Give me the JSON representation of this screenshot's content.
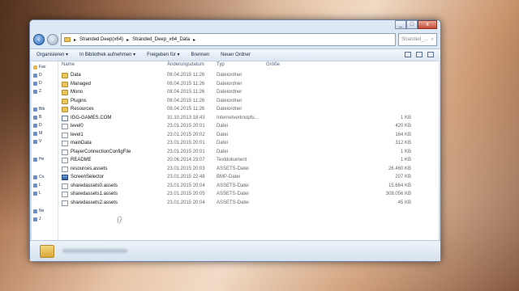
{
  "window": {
    "caption_buttons": [
      "minimize",
      "maximize",
      "close"
    ],
    "address": {
      "segments": [
        "Stranded Deep(x64)",
        "Stranded_Deep_x64_Data"
      ],
      "separator": "▸"
    },
    "search_placeholder": "Stranded_...",
    "toolbar": {
      "organize": "Organisieren ▾",
      "include_library": "In Bibliothek aufnehmen ▾",
      "share": "Freigeben für ▾",
      "burn": "Brennen",
      "new_folder": "Neuer Ordner"
    },
    "navpane": [
      {
        "label": "Fav",
        "icon": "star-icon"
      },
      {
        "label": "D",
        "icon": "folder-icon"
      },
      {
        "label": "D",
        "icon": "folder-icon"
      },
      {
        "label": "Z",
        "icon": "folder-icon"
      },
      {
        "label": "Bib",
        "icon": "library-icon"
      },
      {
        "label": "B",
        "icon": "folder-icon"
      },
      {
        "label": "D",
        "icon": "folder-icon"
      },
      {
        "label": "M",
        "icon": "folder-icon"
      },
      {
        "label": "V",
        "icon": "folder-icon"
      },
      {
        "label": "He",
        "icon": "homegroup-icon"
      },
      {
        "label": "Co",
        "icon": "computer-icon"
      },
      {
        "label": "L",
        "icon": "drive-icon"
      },
      {
        "label": "L",
        "icon": "drive-icon"
      },
      {
        "label": "Ne",
        "icon": "network-icon"
      },
      {
        "label": "J",
        "icon": "computer-icon"
      }
    ],
    "columns": {
      "name": "Name",
      "date": "Änderungsdatum",
      "type": "Typ",
      "size": "Größe"
    },
    "files": [
      {
        "name": "Data",
        "date": "08.04.2015 11:26",
        "type": "Dateiordner",
        "size": "",
        "icon": "folder"
      },
      {
        "name": "Managed",
        "date": "08.04.2015 11:26",
        "type": "Dateiordner",
        "size": "",
        "icon": "folder"
      },
      {
        "name": "Mono",
        "date": "08.04.2015 11:26",
        "type": "Dateiordner",
        "size": "",
        "icon": "folder"
      },
      {
        "name": "Plugins",
        "date": "08.04.2015 11:26",
        "type": "Dateiordner",
        "size": "",
        "icon": "folder"
      },
      {
        "name": "Resources",
        "date": "08.04.2015 11:26",
        "type": "Dateiordner",
        "size": "",
        "icon": "folder"
      },
      {
        "name": "IGG-GAMES.COM",
        "date": "31.10.2013 18:43",
        "type": "Internetverknüpfu...",
        "size": "1 KB",
        "icon": "url"
      },
      {
        "name": "level0",
        "date": "23.01.2015 20:01",
        "type": "Datei",
        "size": "420 KB",
        "icon": "file"
      },
      {
        "name": "level1",
        "date": "23.01.2015 20:02",
        "type": "Datei",
        "size": "164 KB",
        "icon": "file"
      },
      {
        "name": "mainData",
        "date": "23.01.2015 20:01",
        "type": "Datei",
        "size": "312 KB",
        "icon": "file"
      },
      {
        "name": "PlayerConnectionConfigFile",
        "date": "23.01.2015 20:01",
        "type": "Datei",
        "size": "1 KB",
        "icon": "file"
      },
      {
        "name": "README",
        "date": "20.06.2014 23:07",
        "type": "Textdokument",
        "size": "1 KB",
        "icon": "file"
      },
      {
        "name": "resources.assets",
        "date": "23.01.2015 20:03",
        "type": "ASSETS-Datei",
        "size": "26.460 KB",
        "icon": "file"
      },
      {
        "name": "ScreenSelector",
        "date": "23.01.2015 22:48",
        "type": "BMP-Datei",
        "size": "207 KB",
        "icon": "bmp"
      },
      {
        "name": "sharedassets0.assets",
        "date": "23.01.2015 20:04",
        "type": "ASSETS-Datei",
        "size": "15.664 KB",
        "icon": "file"
      },
      {
        "name": "sharedassets1.assets",
        "date": "23.01.2015 20:05",
        "type": "ASSETS-Datei",
        "size": "308.056 KB",
        "icon": "file"
      },
      {
        "name": "sharedassets2.assets",
        "date": "23.01.2015 20:04",
        "type": "ASSETS-Datei",
        "size": "45 KB",
        "icon": "file"
      }
    ]
  }
}
